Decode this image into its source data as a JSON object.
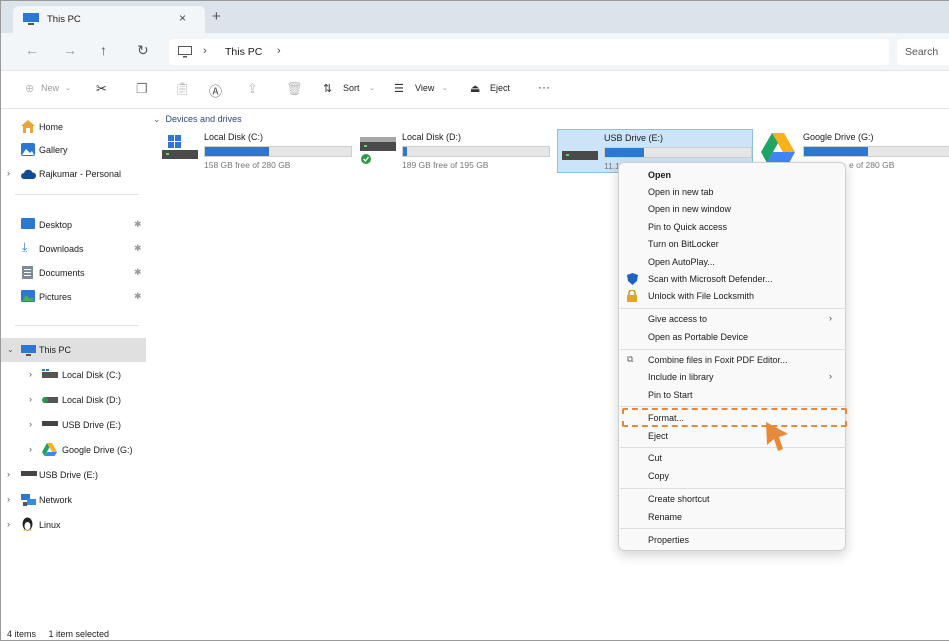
{
  "tab": {
    "title": "This PC",
    "close_glyph": "×",
    "new_glyph": "+"
  },
  "address": {
    "location": "This PC",
    "search_placeholder": "Search"
  },
  "commands": {
    "new": "New",
    "sort": "Sort",
    "view": "View",
    "eject": "Eject",
    "more": "···"
  },
  "nav": {
    "home": "Home",
    "gallery": "Gallery",
    "personal": "Rajkumar - Personal",
    "desktop": "Desktop",
    "downloads": "Downloads",
    "documents": "Documents",
    "pictures": "Pictures",
    "this_pc": "This PC",
    "local_c": "Local Disk (C:)",
    "local_d": "Local Disk (D:)",
    "usb_e": "USB Drive (E:)",
    "gdrive": "Google Drive (G:)",
    "usb_e_root": "USB Drive (E:)",
    "network": "Network",
    "linux": "Linux"
  },
  "main": {
    "group": "Devices and drives",
    "drives": [
      {
        "name": "Local Disk (C:)",
        "free": "158 GB free of 280 GB",
        "used": 0.44
      },
      {
        "name": "Local Disk (D:)",
        "free": "189 GB free of 195 GB",
        "used": 0.03
      },
      {
        "name": "USB Drive (E:)",
        "free": "11.1",
        "used": 0.27
      },
      {
        "name": "Google Drive (G:)",
        "free": "e of 280 GB",
        "used": 0.44
      }
    ]
  },
  "menu": {
    "open": "Open",
    "open_new_tab": "Open in new tab",
    "open_new_window": "Open in new window",
    "pin_quick": "Pin to Quick access",
    "bitlocker": "Turn on BitLocker",
    "autoplay": "Open AutoPlay...",
    "defender": "Scan with Microsoft Defender...",
    "locksmith": "Unlock with File Locksmith",
    "give_access": "Give access to",
    "portable": "Open as Portable Device",
    "foxit": "Combine files in Foxit PDF Editor...",
    "library": "Include in library",
    "pin_start": "Pin to Start",
    "format": "Format...",
    "eject": "Eject",
    "cut": "Cut",
    "copy": "Copy",
    "shortcut": "Create shortcut",
    "rename": "Rename",
    "properties": "Properties"
  },
  "status": {
    "items": "4 items",
    "selected": "1 item selected"
  },
  "colors": {
    "accent": "#2a78d2",
    "highlight": "#e8883a",
    "selected_bg": "#cce4f7"
  }
}
